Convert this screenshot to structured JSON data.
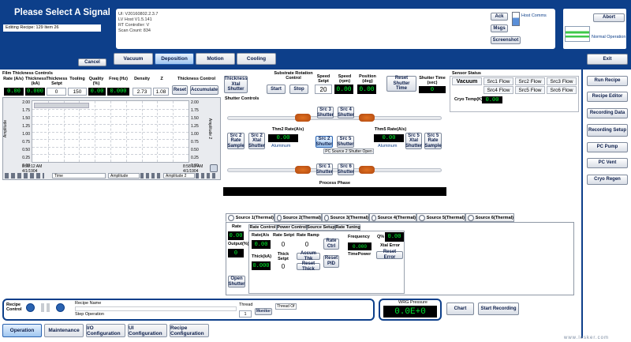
{
  "header": {
    "title": "Please Select A Signal",
    "editing_recipe": "Editing Recipe: 129 Item 26",
    "cancel_label": "Cancel",
    "info_lines": [
      "UI: V20160802.2.3.7",
      "LV Host V1.5.141",
      "RT Controller: V",
      "Scan Count: 834"
    ],
    "ack_label": "Ack",
    "msgs_label": "Msgs",
    "screenshot_label": "Screenshot",
    "host_comms_label": "Host Comms",
    "abort_label": "Abort",
    "normal_operation_label": "Normal Operation",
    "exit_label": "Exit"
  },
  "tabs": [
    {
      "label": "Vacuum",
      "active": false
    },
    {
      "label": "Deposition",
      "active": true
    },
    {
      "label": "Motion",
      "active": false
    },
    {
      "label": "Cooling",
      "active": false
    }
  ],
  "film": {
    "title": "Film Thickness Controls",
    "headers": [
      "Rate (A/s)",
      "Thickness (kA)",
      "Thickness Setpt",
      "Tooling",
      "Quality (%)",
      "Freq (Hz)",
      "Density",
      "Z"
    ],
    "values": [
      "0.00",
      "0.000",
      "0",
      "150",
      "0.00",
      "0.000",
      "2.73",
      "1.08"
    ],
    "thickness_control_label": "Thickness Control",
    "reset_label": "Reset",
    "accumulate_label": "Accumulate"
  },
  "graph": {
    "y_ticks": [
      "2.00",
      "1.75",
      "1.50",
      "1.25",
      "1.00",
      "0.75",
      "0.50",
      "0.25",
      "0.00"
    ],
    "y_label": "Amplitude",
    "y2_label": "Amplitude 2",
    "x_start": "8:58:12 AM",
    "x_end": "8:58:13 AM",
    "x_start_date": "4/1/1904",
    "x_end_date": "4/1/1904",
    "legend": [
      "Time",
      "Amplitude",
      "Amplitude 2"
    ]
  },
  "substrate": {
    "title": "Substrate Rotation Control",
    "start_label": "Start",
    "stop_label": "Stop",
    "speed_setpt_label": "Speed Setpt",
    "speed_setpt": "20",
    "speed_label": "Speed (rpm)",
    "speed": "0.00",
    "position_label": "Position (deg)",
    "position": "0.00"
  },
  "thickness_xtal_shutter_label": "Thickness Xtal Shutter",
  "shutter_controls_label": "Shutter Controls",
  "reset_shutter_time_label": "Reset Shutter Time",
  "shutter_time_label": "Shutter Time (sec)",
  "shutter_time": "0",
  "schematic": {
    "src3": "Src 3 Shutter",
    "src4": "Src 4 Shutter",
    "src2_rate_sample": "Src 2 Rate Sample",
    "src2_xtal_shutter": "Src 2 Xtal Shutter",
    "src2_shutter": "Src 2 Shutter",
    "src5_shutter": "Src 5 Shutter",
    "src5_xtal_shutter": "Src 5 Xtal Shutter",
    "src5_rate_sample": "Src 5 Rate Sample",
    "src1": "Src 1 Shutter",
    "src6": "Src 6 Shutter",
    "thm2_label": "Thm2 Rate(A/s)",
    "thm2_value": "0.00",
    "thm2_material": "Aluminum",
    "thm5_label": "Thm5 Rate(A/s)",
    "thm5_value": "0.00",
    "thm5_material": "Aluminum",
    "pc_status": "PC Source 2 Shutter Open"
  },
  "process_phase_label": "Process Phase",
  "sensor": {
    "title": "Sensor Status",
    "vacuum_label": "Vacuum",
    "flows_row1": [
      "Src1 Flow",
      "Src2 Flow",
      "Src3 Flow"
    ],
    "flows_row2": [
      "Src4 Flow",
      "Src5 Flow",
      "Src6 Flow"
    ],
    "cryo_label": "Cryo Temp(K)",
    "cryo_value": "0.00"
  },
  "side_buttons": [
    "Run Recipe",
    "Recipe Editor",
    "Recording Data",
    "Recording Setup",
    "PC Pump",
    "PC Vent",
    "Cryo Regen"
  ],
  "sources": {
    "tabs": [
      "Source 1(Thermal)",
      "Source 2(Thermal)",
      "Source 3(Thermal)",
      "Source 4(Thermal)",
      "Source 5(Thermal)",
      "Source 6(Thermal)"
    ],
    "inner_tabs": [
      "Rate Control",
      "Power Control",
      "Source Setup",
      "Rate Tuning"
    ],
    "rate_label": "Rate",
    "rate": "0.00",
    "output_label": "Output(%)",
    "output": "0",
    "open_shutter_label": "Open Shutter",
    "rate_as_label": "Rate(A/s",
    "rate_as": "0.00",
    "rate_setpt_label": "Rate Setpt",
    "rate_setpt": "0",
    "rate_ramp_label": "Rate Ramp",
    "rate_ramp": "0",
    "rate_ctrl_label": "Rate Ctrl",
    "thick_label": "Thick(kA)",
    "thick": "0.000",
    "thick_setpt_label": "Thick Setpt",
    "thick_setpt": "0",
    "accum_thk_label": "Accum Thk",
    "reset_thick_label": "Reset Thick",
    "reset_pid_label": "Reset PID",
    "frequency_label": "Frequency",
    "frequency": "0.000",
    "q_label": "Q%",
    "q_value": "0.00",
    "timepower_label": "TimePower",
    "xtal_error_label": "Xtal Error",
    "reset_error_label": "Reset Error"
  },
  "recipe": {
    "control_label": "Recipe Control",
    "name_label": "Recipe Name",
    "step_label": "Step Operation",
    "thread_label": "Thread",
    "thread_value": "1",
    "thread_of": "Thread Of",
    "monitor_label": "Monitor"
  },
  "wrg": {
    "label": "WRG Pressure",
    "value": "0.0E+0"
  },
  "chart_label": "Chart",
  "start_recording_label": "Start Recording",
  "bottom_tabs": [
    "Operation",
    "Maintenance",
    "I/O Configuration",
    "UI Configuration",
    "Recipe Configuration"
  ],
  "footer_url": "www.lesker.com"
}
